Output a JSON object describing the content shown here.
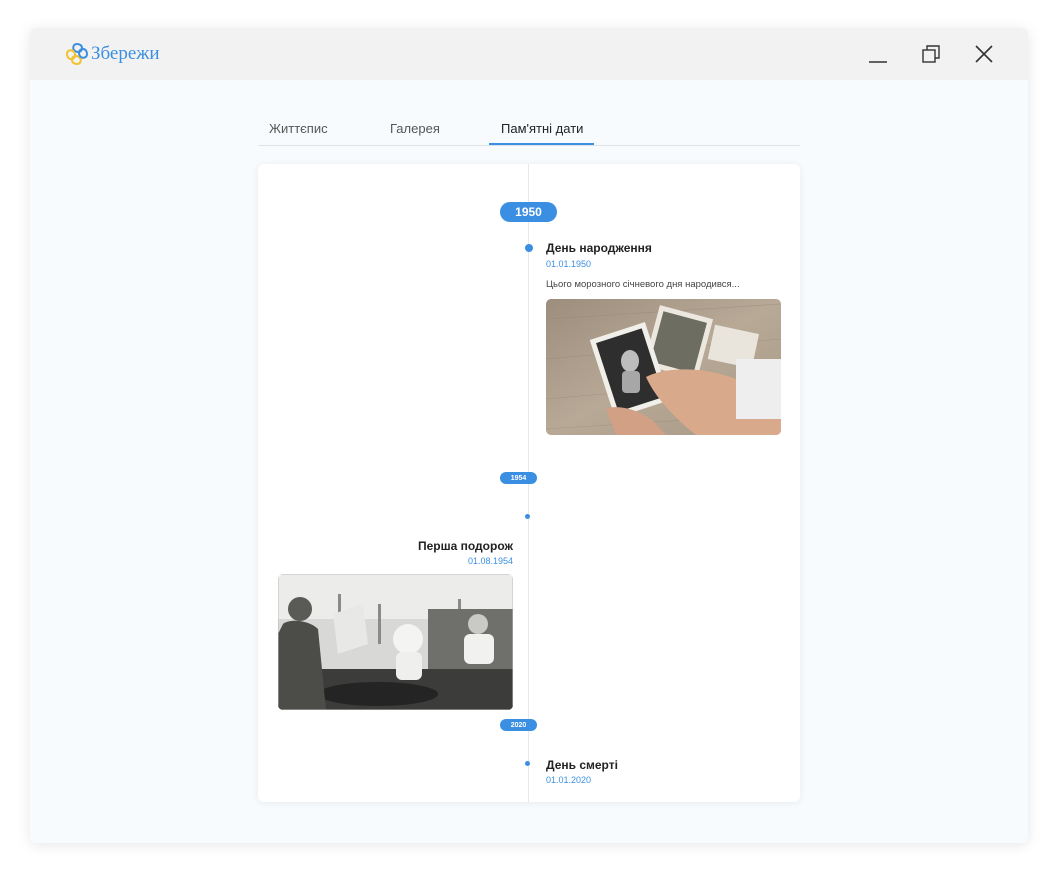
{
  "app": {
    "logo_text": "Збережи",
    "logo_icon": "knot-logo-icon"
  },
  "window_controls": {
    "minimize_icon": "minimize-icon",
    "maximize_icon": "restore-icon",
    "close_icon": "close-icon"
  },
  "tabs": [
    {
      "label": "Життєпис",
      "active": false
    },
    {
      "label": "Галерея",
      "active": false
    },
    {
      "label": "Пам'ятні дати",
      "active": true
    }
  ],
  "timeline": {
    "years": [
      "1950",
      "1954",
      "2020"
    ],
    "events": [
      {
        "title": "День народження",
        "date": "01.01.1950",
        "description": "Цього морозного січневого дня народився..."
      },
      {
        "title": "Перша подорож",
        "date": "01.08.1954"
      },
      {
        "title": "День смерті",
        "date": "01.01.2020"
      }
    ]
  },
  "colors": {
    "accent": "#3b8fe2",
    "logo_yellow": "#f2c12e",
    "titlebar_bg": "#f2f2f2",
    "window_bg": "#f8fbfd"
  }
}
